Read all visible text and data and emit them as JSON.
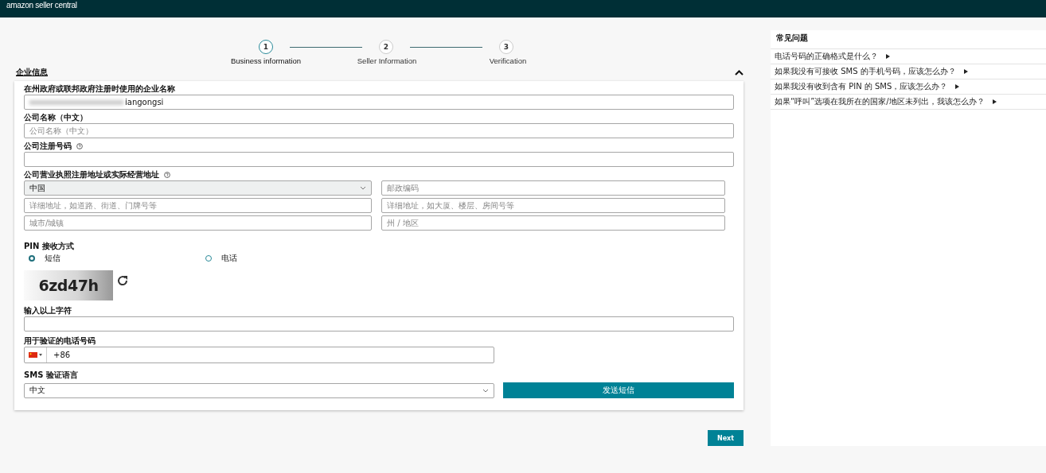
{
  "header": {
    "logo": "amazon seller central"
  },
  "steps": [
    {
      "number": "1",
      "label": "Business information",
      "selected": true
    },
    {
      "number": "2",
      "label": "Seller Information",
      "selected": false
    },
    {
      "number": "3",
      "label": "Verification",
      "selected": false
    }
  ],
  "section": {
    "title": "企业信息",
    "expanded": true
  },
  "form": {
    "legal_name": {
      "label": "在州政府或联邦政府注册时使用的企业名称",
      "value": "iangongsi"
    },
    "company_name_cn": {
      "label": "公司名称（中文）",
      "placeholder": "公司名称（中文）"
    },
    "registration_number": {
      "label": "公司注册号码"
    },
    "address": {
      "label": "公司营业执照注册地址或实际经营地址",
      "country": "中国",
      "postal_code_placeholder": "邮政编码",
      "line1_placeholder": "详细地址，如道路、街道、门牌号等",
      "line2_placeholder": "详细地址，如大厦、楼层、房间号等",
      "city_placeholder": "城市/城镇",
      "state_placeholder": "州 / 地区"
    },
    "pin_method": {
      "label": "PIN 接收方式",
      "options": [
        {
          "label": "短信",
          "selected": true
        },
        {
          "label": "电话",
          "selected": false
        }
      ]
    },
    "captcha": {
      "text": "6zd47h"
    },
    "captcha_input": {
      "label": "输入以上字符"
    },
    "phone": {
      "label": "用于验证的电话号码",
      "value": "+86"
    },
    "sms_language": {
      "label": "SMS 验证语言",
      "value": "中文"
    },
    "send_button": "发送短信"
  },
  "next_button": "Next",
  "faq": {
    "title": "常见问题",
    "items": [
      "电话号码的正确格式是什么？",
      "如果我没有可接收 SMS 的手机号码，应该怎么办？",
      "如果我没有收到含有 PIN 的 SMS，应该怎么办？",
      "如果“呼叫”选项在我所在的国家/地区未列出，我该怎么办？"
    ]
  }
}
